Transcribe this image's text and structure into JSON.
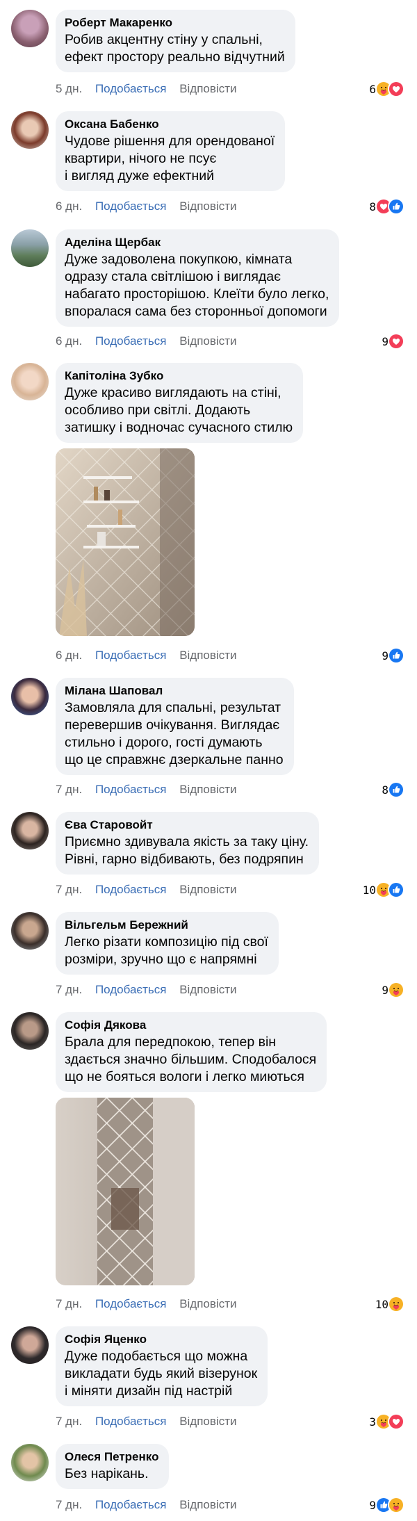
{
  "colors": {
    "bubble": "#f0f2f5",
    "like_link": "#3a6db5",
    "meta_gray": "#65676b",
    "like_icon": "#1877f2",
    "love_icon": "#f33e58",
    "care_icon": "#f7b125"
  },
  "labels": {
    "like": "Подобається",
    "reply": "Відповісти"
  },
  "comments": [
    {
      "author": "Роберт Макаренко",
      "text": "Робив акцентну стіну у спальні,\nефект простору реально відчутний",
      "time": "5 дн.",
      "count": "6",
      "reactions": [
        "care-icon",
        "love-icon"
      ]
    },
    {
      "author": "Оксана Бабенко",
      "text": "Чудове рішення для орендованої\nквартири, нічого не псує\nі вигляд дуже ефектний",
      "time": "6 дн.",
      "count": "8",
      "reactions": [
        "love-icon",
        "like-icon"
      ]
    },
    {
      "author": "Аделіна Щербак",
      "text": "Дуже задоволена покупкою, кімната\nодразу стала світлішою і виглядає\nнабагато просторішою. Клеїти було легко,\nвпоралася сама без сторонньої допомоги",
      "time": "6 дн.",
      "count": "9",
      "reactions": [
        "love-icon"
      ]
    },
    {
      "author": "Капітоліна Зубко",
      "text": "Дуже красиво виглядають на стіні,\nособливо при світлі. Додають\nзатишку і водночас сучасного стилю",
      "time": "6 дн.",
      "count": "9",
      "reactions": [
        "like-icon"
      ],
      "photo": "shelves"
    },
    {
      "author": "Мілана Шаповал",
      "text": "Замовляла для спальні, результат\nперевершив очікування. Виглядає\nстильно і дорого, гості думають\nщо це справжнє дзеркальне панно",
      "time": "7 дн.",
      "count": "8",
      "reactions": [
        "like-icon"
      ]
    },
    {
      "author": "Єва Старовойт",
      "text": "Приємно здивувала якість за таку ціну.\nРівні, гарно відбивають, без подряпин",
      "time": "7 дн.",
      "count": "10",
      "reactions": [
        "care-icon",
        "like-icon"
      ]
    },
    {
      "author": "Вільгельм Бережний",
      "text": "Легко різати композицію під свої\nрозміри, зручно що є напрямні",
      "time": "7 дн.",
      "count": "9",
      "reactions": [
        "care-icon"
      ]
    },
    {
      "author": "Софія Дякова",
      "text": "Брала для передпокою, тепер він\nздається значно більшим. Сподобалося\nщо не бояться вологи і легко миються",
      "time": "7 дн.",
      "count": "10",
      "reactions": [
        "care-icon"
      ],
      "photo": "mirror"
    },
    {
      "author": "Софія Яценко",
      "text": "Дуже подобається що можна\nвикладати будь який візерунок\nі міняти дизайн під настрій",
      "time": "7 дн.",
      "count": "3",
      "reactions": [
        "care-icon",
        "love-icon"
      ]
    },
    {
      "author": "Олеся Петренко",
      "text": "Без нарікань.",
      "time": "7 дн.",
      "count": "9",
      "reactions": [
        "like-icon",
        "care-icon"
      ]
    }
  ]
}
